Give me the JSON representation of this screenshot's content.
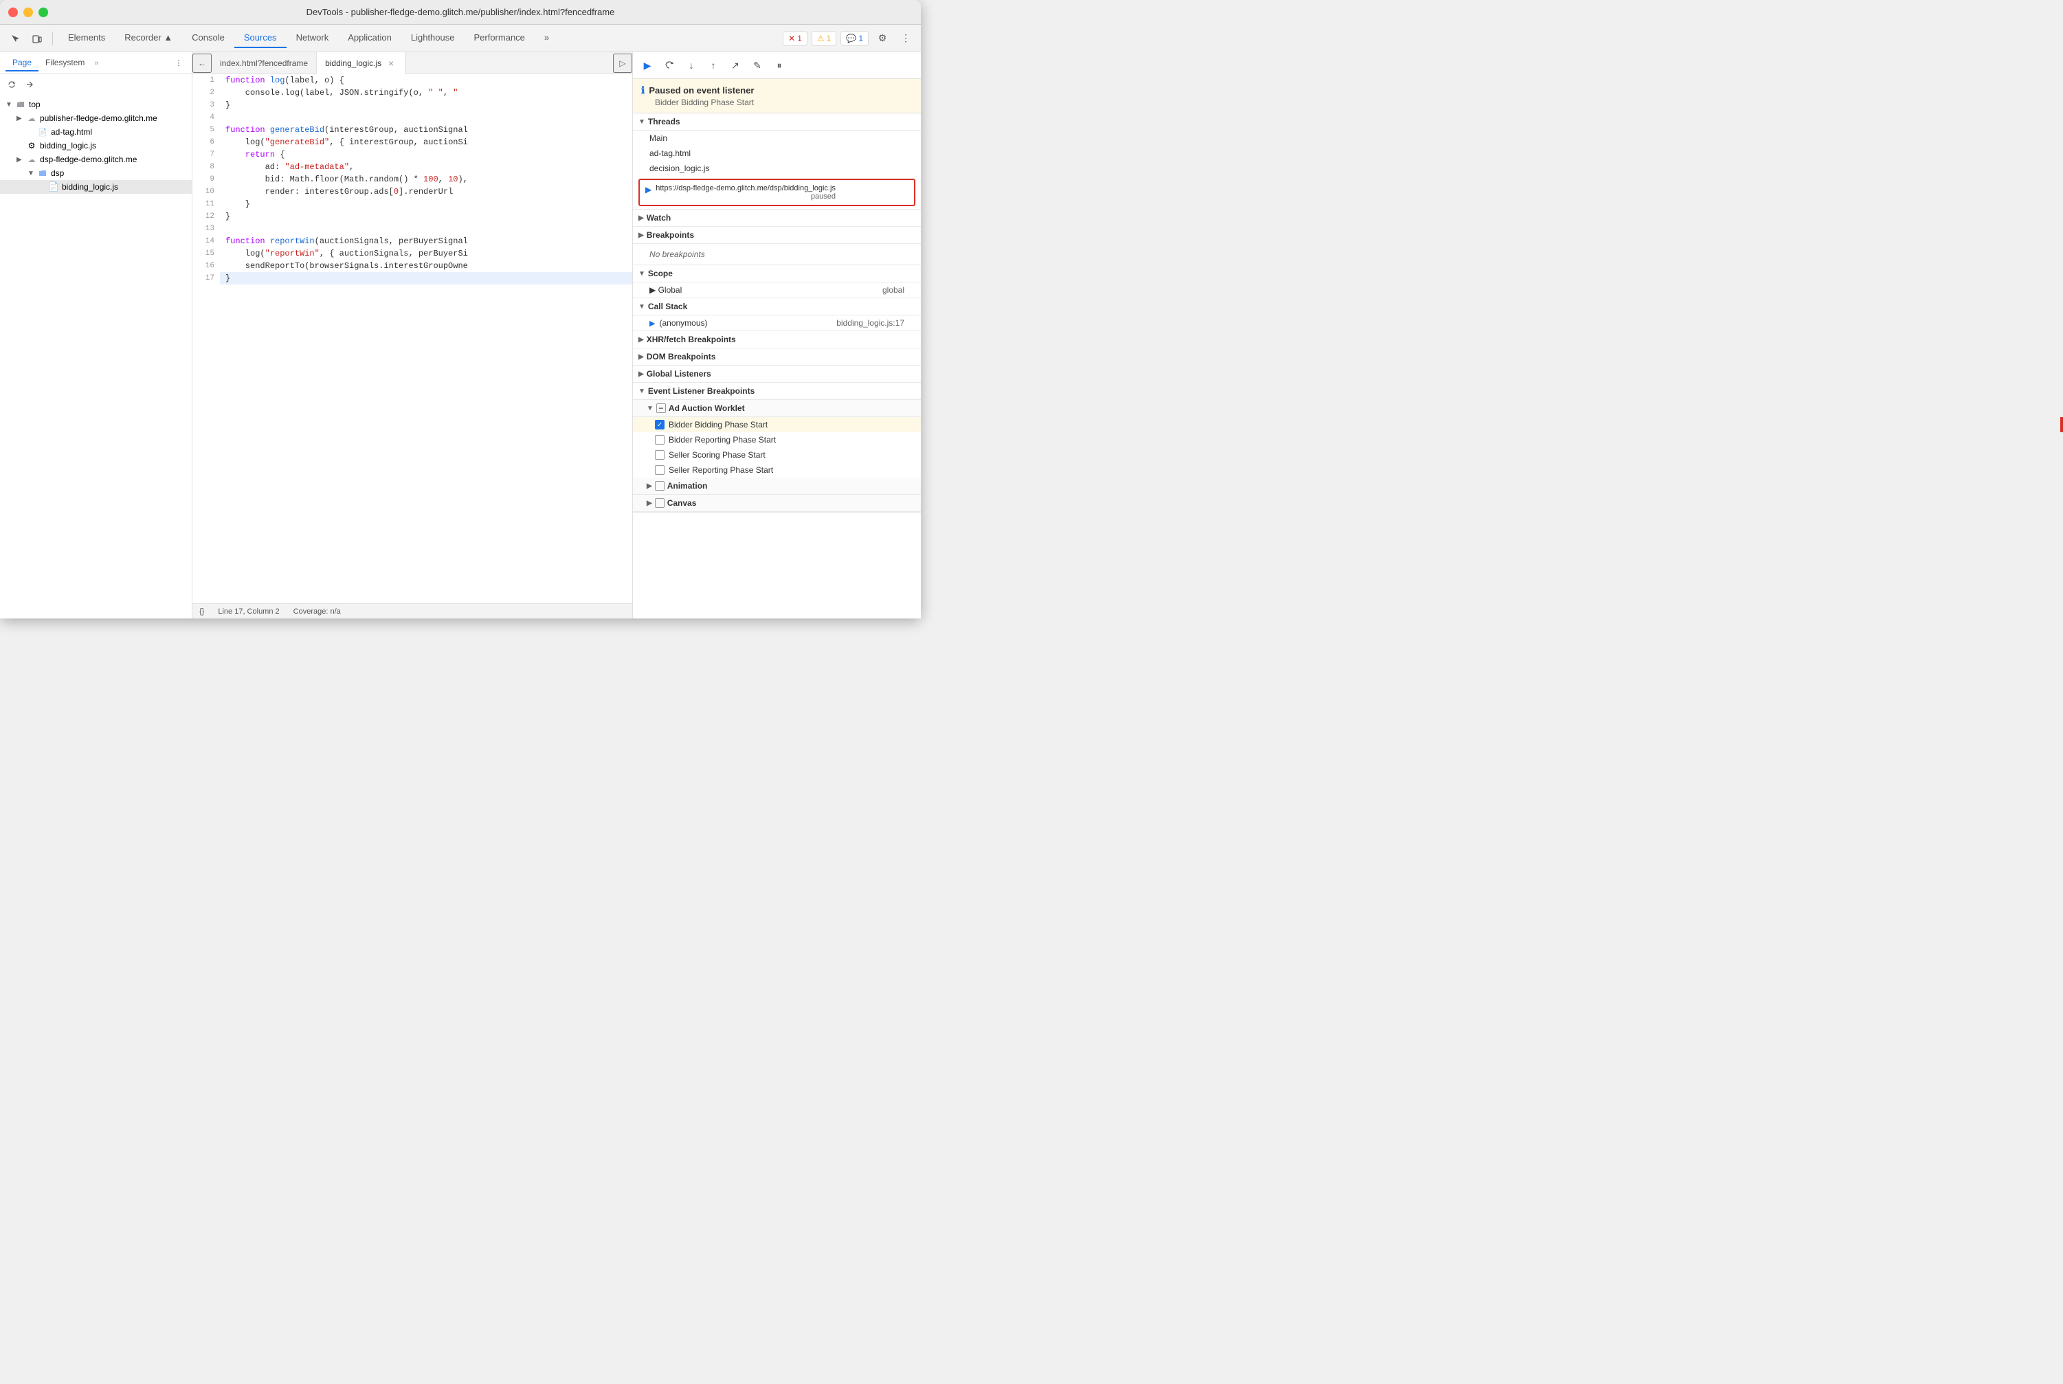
{
  "titleBar": {
    "title": "DevTools - publisher-fledge-demo.glitch.me/publisher/index.html?fencedframe"
  },
  "toolbar": {
    "tabs": [
      {
        "label": "Elements",
        "active": false
      },
      {
        "label": "Recorder ▲",
        "active": false
      },
      {
        "label": "Console",
        "active": false
      },
      {
        "label": "Sources",
        "active": true
      },
      {
        "label": "Network",
        "active": false
      },
      {
        "label": "Application",
        "active": false
      },
      {
        "label": "Lighthouse",
        "active": false
      },
      {
        "label": "Performance",
        "active": false
      }
    ],
    "moreTabsLabel": "»",
    "badges": {
      "error": "1",
      "warning": "1",
      "info": "1"
    },
    "settingsLabel": "⚙",
    "moreLabel": "⋮"
  },
  "leftPanel": {
    "tabs": [
      "Page",
      "Filesystem"
    ],
    "activeTab": "Page",
    "moreLabel": "»",
    "tree": [
      {
        "id": 1,
        "indent": 0,
        "arrow": "▼",
        "icon": "folder",
        "label": "top"
      },
      {
        "id": 2,
        "indent": 1,
        "arrow": "▶",
        "icon": "domain",
        "label": "publisher-fledge-demo.glitch.me"
      },
      {
        "id": 3,
        "indent": 2,
        "arrow": "",
        "icon": "file",
        "label": "ad-tag.html"
      },
      {
        "id": 4,
        "indent": 1,
        "arrow": "",
        "icon": "gear-file",
        "label": "bidding_logic.js",
        "selected": false
      },
      {
        "id": 5,
        "indent": 1,
        "arrow": "▶",
        "icon": "domain",
        "label": "dsp-fledge-demo.glitch.me"
      },
      {
        "id": 6,
        "indent": 2,
        "arrow": "▼",
        "icon": "folder-blue",
        "label": "dsp"
      },
      {
        "id": 7,
        "indent": 3,
        "arrow": "",
        "icon": "file-yellow",
        "label": "bidding_logic.js",
        "selected": true
      }
    ]
  },
  "editorTabs": [
    {
      "label": "index.html?fencedframe",
      "active": false,
      "closeable": false
    },
    {
      "label": "bidding_logic.js",
      "active": true,
      "closeable": true
    }
  ],
  "code": {
    "lines": [
      {
        "num": 1,
        "text": "function log(label, o) {",
        "highlight": false
      },
      {
        "num": 2,
        "text": "    console.log(label, JSON.stringify(o, \" \", \"",
        "highlight": false
      },
      {
        "num": 3,
        "text": "}",
        "highlight": false
      },
      {
        "num": 4,
        "text": "",
        "highlight": false
      },
      {
        "num": 5,
        "text": "function generateBid(interestGroup, auctionSignal",
        "highlight": false
      },
      {
        "num": 6,
        "text": "    log(\"generateBid\", { interestGroup, auctionSi",
        "highlight": false
      },
      {
        "num": 7,
        "text": "    return {",
        "highlight": false
      },
      {
        "num": 8,
        "text": "        ad: \"ad-metadata\",",
        "highlight": false
      },
      {
        "num": 9,
        "text": "        bid: Math.floor(Math.random() * 100, 10),",
        "highlight": false
      },
      {
        "num": 10,
        "text": "        render: interestGroup.ads[0].renderUrl",
        "highlight": false
      },
      {
        "num": 11,
        "text": "    }",
        "highlight": false
      },
      {
        "num": 12,
        "text": "}",
        "highlight": false
      },
      {
        "num": 13,
        "text": "",
        "highlight": false
      },
      {
        "num": 14,
        "text": "function reportWin(auctionSignals, perBuyerSignal",
        "highlight": false
      },
      {
        "num": 15,
        "text": "    log(\"reportWin\", { auctionSignals, perBuyerSi",
        "highlight": false
      },
      {
        "num": 16,
        "text": "    sendReportTo(browserSignals.interestGroupOwne",
        "highlight": false
      },
      {
        "num": 17,
        "text": "}",
        "highlight": true
      }
    ],
    "status": {
      "format": "{}",
      "position": "Line 17, Column 2",
      "coverage": "Coverage: n/a"
    }
  },
  "rightPanel": {
    "debugButtons": [
      "▶",
      "↻",
      "↓",
      "↑",
      "↗",
      "✎",
      "⏸"
    ],
    "pausedBanner": {
      "title": "Paused on event listener",
      "subtitle": "Bidder Bidding Phase Start"
    },
    "sections": {
      "threads": {
        "label": "Threads",
        "items": [
          {
            "label": "Main"
          },
          {
            "label": "ad-tag.html"
          },
          {
            "label": "decision_logic.js"
          },
          {
            "label": "https://dsp-fledge-demo.glitch.me/dsp/bidding_logic.js",
            "status": "paused",
            "active": true
          }
        ]
      },
      "watch": {
        "label": "Watch"
      },
      "breakpoints": {
        "label": "Breakpoints",
        "empty": "No breakpoints"
      },
      "scope": {
        "label": "Scope",
        "items": [
          {
            "label": "▶ Global",
            "value": "global"
          }
        ]
      },
      "callStack": {
        "label": "Call Stack",
        "items": [
          {
            "label": "(anonymous)",
            "location": "bidding_logic.js:17"
          }
        ]
      },
      "xhrBreakpoints": {
        "label": "XHR/fetch Breakpoints"
      },
      "domBreakpoints": {
        "label": "DOM Breakpoints"
      },
      "globalListeners": {
        "label": "Global Listeners"
      },
      "eventListenerBreakpoints": {
        "label": "Event Listener Breakpoints",
        "subGroups": [
          {
            "label": "Ad Auction Worklet",
            "items": [
              {
                "label": "Bidder Bidding Phase Start",
                "checked": true,
                "highlighted": true
              },
              {
                "label": "Bidder Reporting Phase Start",
                "checked": false
              },
              {
                "label": "Seller Scoring Phase Start",
                "checked": false
              },
              {
                "label": "Seller Reporting Phase Start",
                "checked": false
              }
            ]
          },
          {
            "label": "Animation",
            "items": []
          },
          {
            "label": "Canvas",
            "items": []
          }
        ]
      }
    }
  }
}
